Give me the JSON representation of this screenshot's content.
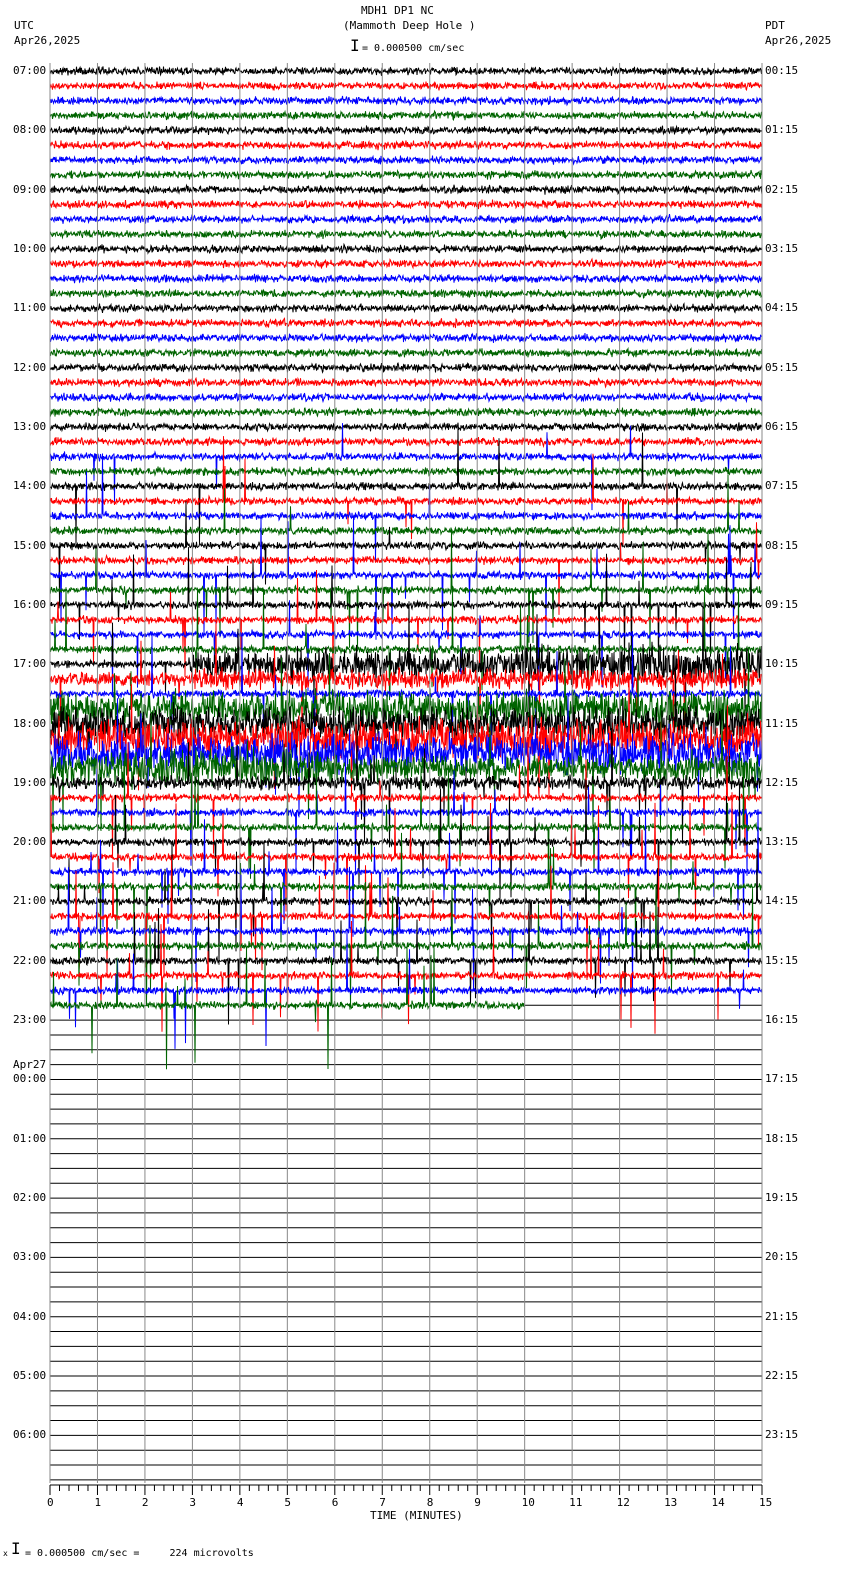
{
  "header": {
    "title": "MDH1 DP1 NC",
    "subtitle": "(Mammoth Deep Hole )",
    "scale": "= 0.000500 cm/sec",
    "left_tz": "UTC",
    "left_date": "Apr26,2025",
    "right_tz": "PDT",
    "right_date": "Apr26,2025"
  },
  "footer": {
    "scale": "= 0.000500 cm/sec =     224 microvolts",
    "prefix": "x"
  },
  "chart_data": {
    "type": "line",
    "title": "MDH1 DP1 NC (Mammoth Deep Hole )",
    "xlabel": "TIME (MINUTES)",
    "xlim": [
      0,
      15
    ],
    "x_ticks": [
      "0",
      "1",
      "2",
      "3",
      "4",
      "5",
      "6",
      "7",
      "8",
      "9",
      "10",
      "11",
      "12",
      "13",
      "14",
      "15"
    ],
    "minutes_per_line": 15,
    "trace_colors": [
      "#000000",
      "#ff0000",
      "#0000ff",
      "#006400"
    ],
    "left_labels": [
      "07:00",
      "08:00",
      "09:00",
      "10:00",
      "11:00",
      "12:00",
      "13:00",
      "14:00",
      "15:00",
      "16:00",
      "17:00",
      "18:00",
      "19:00",
      "20:00",
      "21:00",
      "22:00",
      "23:00",
      "00:00",
      "01:00",
      "02:00",
      "03:00",
      "04:00",
      "05:00",
      "06:00"
    ],
    "date_change_label": "Apr27",
    "right_labels": [
      "00:15",
      "01:15",
      "02:15",
      "03:15",
      "04:15",
      "05:15",
      "06:15",
      "07:15",
      "08:15",
      "09:15",
      "10:15",
      "11:15",
      "12:15",
      "13:15",
      "14:15",
      "15:15",
      "16:15",
      "17:15",
      "18:15",
      "19:15",
      "20:15",
      "21:15",
      "22:15",
      "23:15"
    ],
    "data_end": {
      "line": "22:45",
      "minute": 10
    },
    "strong_shaking_window": "17:00-19:00 UTC"
  }
}
